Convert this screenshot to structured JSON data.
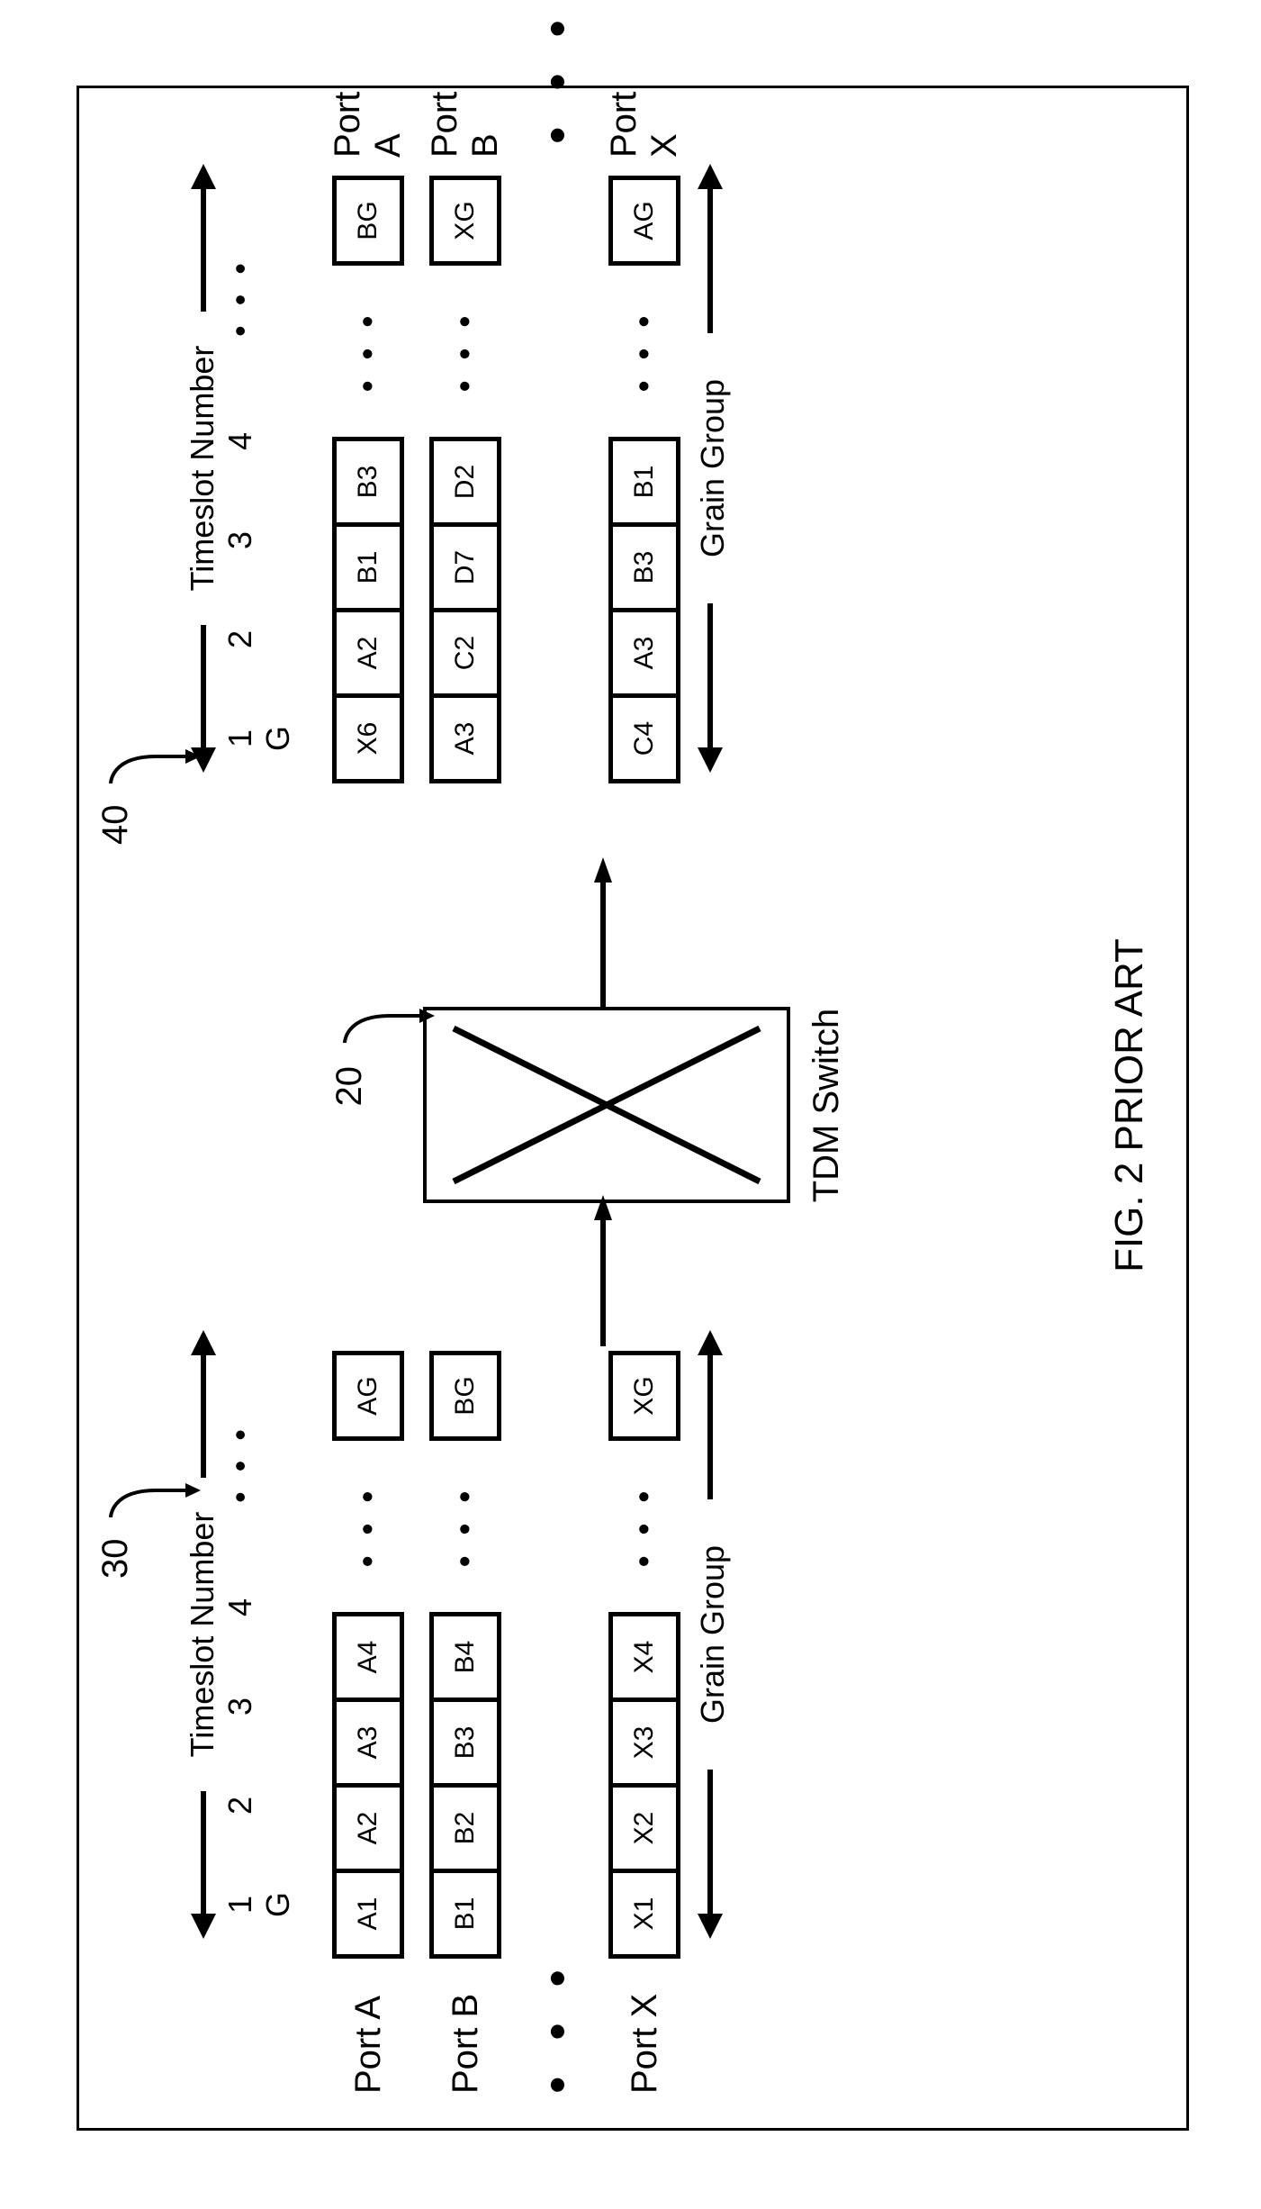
{
  "caption": "FIG. 2 PRIOR ART",
  "switch": {
    "label": "TDM Switch",
    "ref": "20"
  },
  "left": {
    "ref": "30",
    "timeslot_header": "Timeslot Number",
    "footer": "Grain Group",
    "slots": [
      "1",
      "2",
      "3",
      "4",
      "",
      "",
      "",
      "G"
    ],
    "ports": [
      {
        "label": "Port A",
        "cells": [
          "A1",
          "A2",
          "A3",
          "A4",
          "",
          "",
          "",
          "AG"
        ]
      },
      {
        "label": "Port B",
        "cells": [
          "B1",
          "B2",
          "B3",
          "B4",
          "",
          "",
          "",
          "BG"
        ]
      },
      {
        "label": "Port X",
        "cells": [
          "X1",
          "X2",
          "X3",
          "X4",
          "",
          "",
          "",
          "XG"
        ]
      }
    ]
  },
  "right": {
    "ref": "40",
    "timeslot_header": "Timeslot Number",
    "footer": "Grain Group",
    "slots": [
      "1",
      "2",
      "3",
      "4",
      "",
      "",
      "",
      "G"
    ],
    "ports": [
      {
        "label": "Port A",
        "cells": [
          "X6",
          "A2",
          "B1",
          "B3",
          "",
          "",
          "",
          "BG"
        ]
      },
      {
        "label": "Port B",
        "cells": [
          "A3",
          "C2",
          "D7",
          "D2",
          "",
          "",
          "",
          "XG"
        ]
      },
      {
        "label": "Port X",
        "cells": [
          "C4",
          "A3",
          "B3",
          "B1",
          "",
          "",
          "",
          "AG"
        ]
      }
    ]
  },
  "dots": "•  •  •",
  "ellipsis": "•  •  •"
}
